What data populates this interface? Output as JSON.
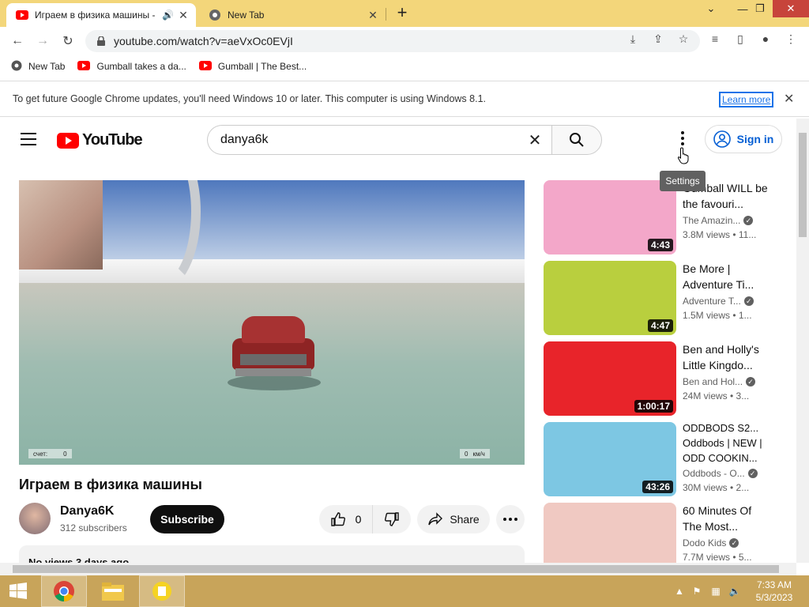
{
  "browser": {
    "tabs": [
      {
        "title": "Играем в физика машины -",
        "active": true
      },
      {
        "title": "New Tab",
        "active": false
      }
    ],
    "url": "youtube.com/watch?v=aeVxOc0EVjI",
    "bookmarks": [
      "New Tab",
      "Gumball takes a da...",
      "Gumball | The Best..."
    ],
    "infobar": {
      "message": "To get future Google Chrome updates, you'll need Windows 10 or later. This computer is using Windows 8.1.",
      "link": "Learn more"
    }
  },
  "youtube": {
    "logo": "YouTube",
    "search_query": "danya6k",
    "signin": "Sign in",
    "tooltip": "Settings",
    "player_hud": {
      "score_label": "счет:",
      "score": "0",
      "speed": "0",
      "speed_unit": "км/ч"
    },
    "video_title": "Играем в физика машины",
    "channel": {
      "name": "Danya6K",
      "subscribers": "312 subscribers",
      "subscribe": "Subscribe"
    },
    "likes": "0",
    "share": "Share",
    "description": "No views  3 days ago",
    "recommendations": [
      {
        "title": "Gumball WILL be the favouri...",
        "channel": "The Amazin...",
        "meta": "3.8M views  •  11...",
        "duration": "4:43",
        "thumb_color": "#f3a7c9"
      },
      {
        "title": "Be More | Adventure Ti...",
        "channel": "Adventure T...",
        "meta": "1.5M views  •  1...",
        "duration": "4:47",
        "thumb_color": "#b9cf3e"
      },
      {
        "title": "Ben and Holly's Little Kingdo...",
        "channel": "Ben and Hol...",
        "meta": "24M views  •  3...",
        "duration": "1:00:17",
        "thumb_color": "#e8242a"
      },
      {
        "title": "ODDBODS  S2... Oddbods | NEW | ODD COOKIN...",
        "channel": "Oddbods - O...",
        "meta": "30M views  •  2...",
        "duration": "43:26",
        "thumb_color": "#7dc7e3"
      },
      {
        "title": "60 Minutes Of The Most...",
        "channel": "Dodo Kids",
        "meta": "7.7M views  •  5...",
        "duration": "",
        "thumb_color": "#f0c9c2"
      }
    ]
  },
  "taskbar": {
    "time": "7:33 AM",
    "date": "5/3/2023"
  }
}
